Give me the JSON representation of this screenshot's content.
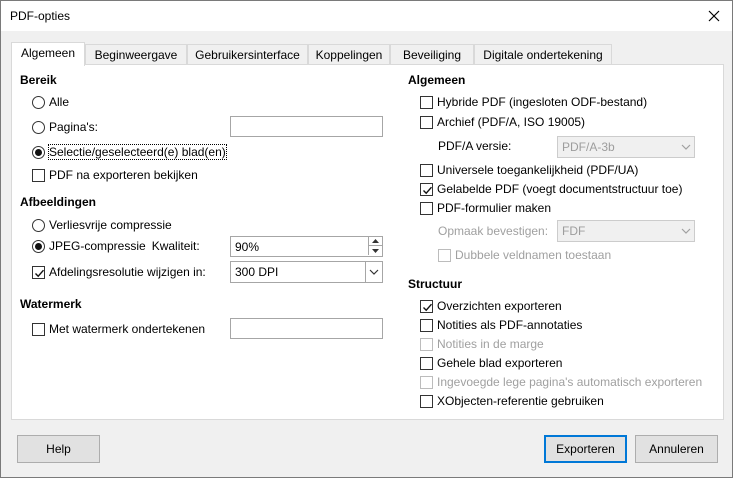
{
  "window": {
    "title": "PDF-opties"
  },
  "tabs": [
    {
      "label": "Algemeen",
      "active": true
    },
    {
      "label": "Beginweergave",
      "active": false
    },
    {
      "label": "Gebruikersinterface",
      "active": false
    },
    {
      "label": "Koppelingen",
      "active": false
    },
    {
      "label": "Beveiliging",
      "active": false
    },
    {
      "label": "Digitale ondertekening",
      "active": false
    }
  ],
  "range": {
    "heading": "Bereik",
    "all": "Alle",
    "pages": "Pagina's:",
    "pages_value": "",
    "selection": "Selectie/geselecteerd(e) blad(en)",
    "selected": "selection",
    "view_after_export": "PDF na exporteren bekijken",
    "view_after_export_checked": false
  },
  "images": {
    "heading": "Afbeeldingen",
    "lossless": "Verliesvrije compressie",
    "jpeg": "JPEG-compressie",
    "quality_label": "Kwaliteit:",
    "quality_value": "90%",
    "reduce_resolution": "Afdelingsresolutie wijzigen in:",
    "reduce_resolution_checked": true,
    "resolution_value": "300 DPI",
    "selected": "jpeg"
  },
  "watermark": {
    "heading": "Watermerk",
    "sign": "Met watermerk ondertekenen",
    "sign_checked": false,
    "text_value": ""
  },
  "general": {
    "heading": "Algemeen",
    "hybrid": "Hybride PDF (ingesloten ODF-bestand)",
    "hybrid_checked": false,
    "archive": "Archief (PDF/A, ISO 19005)",
    "archive_checked": false,
    "pdfa_label": "PDF/A versie:",
    "pdfa_value": "PDF/A-3b",
    "universal": "Universele toegankelijkheid (PDF/UA)",
    "universal_checked": false,
    "tagged": "Gelabelde PDF (voegt documentstructuur toe)",
    "tagged_checked": true,
    "form": "PDF-formulier maken",
    "form_checked": false,
    "submit_label": "Opmaak bevestigen:",
    "submit_value": "FDF",
    "duplicate_names": "Dubbele veldnamen toestaan",
    "duplicate_names_checked": false
  },
  "structure": {
    "heading": "Structuur",
    "outlines": "Overzichten exporteren",
    "outlines_checked": true,
    "comments": "Notities als PDF-annotaties",
    "comments_checked": false,
    "comments_margin": "Notities in de marge",
    "comments_margin_checked": false,
    "whole_sheet": "Gehele blad exporteren",
    "whole_sheet_checked": false,
    "blank_pages": "Ingevoegde lege pagina's automatisch exporteren",
    "blank_pages_checked": false,
    "xobjects": "XObjecten-referentie gebruiken",
    "xobjects_checked": false
  },
  "buttons": {
    "help": "Help",
    "export": "Exporteren",
    "cancel": "Annuleren"
  }
}
